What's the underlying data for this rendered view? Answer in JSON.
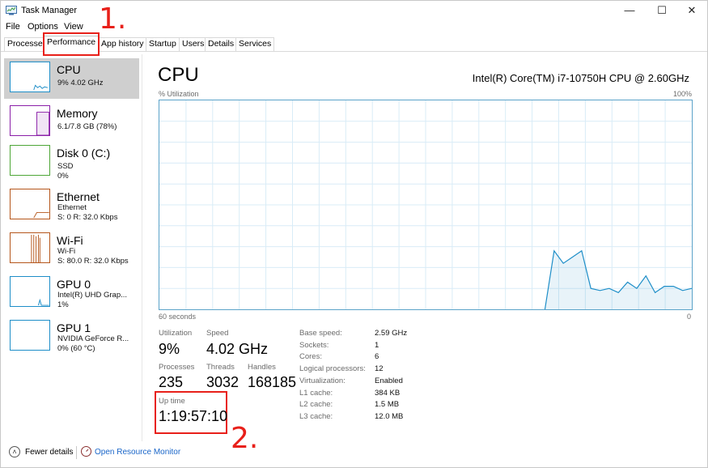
{
  "window": {
    "title": "Task Manager",
    "controls": {
      "minimize": "—",
      "maximize": "☐",
      "close": "✕"
    }
  },
  "menu": [
    "File",
    "Options",
    "View"
  ],
  "tabs": [
    {
      "label": "Processes",
      "active": false
    },
    {
      "label": "Performance",
      "active": true
    },
    {
      "label": "App history",
      "active": false
    },
    {
      "label": "Startup",
      "active": false
    },
    {
      "label": "Users",
      "active": false
    },
    {
      "label": "Details",
      "active": false
    },
    {
      "label": "Services",
      "active": false
    }
  ],
  "annotations": {
    "step1": "1.",
    "step2": "2."
  },
  "sidebar": [
    {
      "title": "CPU",
      "sub1": "9%  4.02 GHz",
      "color": "#1e8ec8",
      "selected": true
    },
    {
      "title": "Memory",
      "sub1": "6.1/7.8 GB (78%)",
      "color": "#8b1fa8",
      "selected": false
    },
    {
      "title": "Disk 0 (C:)",
      "sub1": "SSD",
      "sub2": "0%",
      "color": "#4da636",
      "selected": false
    },
    {
      "title": "Ethernet",
      "sub1": "Ethernet",
      "sub2": "S: 0  R: 32.0 Kbps",
      "color": "#b5561b",
      "selected": false
    },
    {
      "title": "Wi-Fi",
      "sub1": "Wi-Fi",
      "sub2": "S: 80.0  R: 32.0 Kbps",
      "color": "#b5561b",
      "selected": false
    },
    {
      "title": "GPU 0",
      "sub1": "Intel(R) UHD Grap...",
      "sub2": "1%",
      "color": "#1e8ec8",
      "selected": false
    },
    {
      "title": "GPU 1",
      "sub1": "NVIDIA GeForce R...",
      "sub2": "0%  (60 °C)",
      "color": "#1e8ec8",
      "selected": false
    }
  ],
  "main": {
    "title": "CPU",
    "cpu_name": "Intel(R) Core(TM) i7-10750H CPU @ 2.60GHz",
    "axis": {
      "top_left": "% Utilization",
      "top_right": "100%",
      "bottom_left": "60 seconds",
      "bottom_right": "0"
    },
    "stats": {
      "utilization": {
        "label": "Utilization",
        "value": "9%"
      },
      "speed": {
        "label": "Speed",
        "value": "4.02 GHz"
      },
      "processes": {
        "label": "Processes",
        "value": "235"
      },
      "threads": {
        "label": "Threads",
        "value": "3032"
      },
      "handles": {
        "label": "Handles",
        "value": "168185"
      },
      "uptime": {
        "label": "Up time",
        "value": "1:19:57:10"
      }
    },
    "details": [
      {
        "label": "Base speed:",
        "value": "2.59 GHz"
      },
      {
        "label": "Sockets:",
        "value": "1"
      },
      {
        "label": "Cores:",
        "value": "6"
      },
      {
        "label": "Logical processors:",
        "value": "12"
      },
      {
        "label": "Virtualization:",
        "value": "Enabled"
      },
      {
        "label": "L1 cache:",
        "value": "384 KB"
      },
      {
        "label": "L2 cache:",
        "value": "1.5 MB"
      },
      {
        "label": "L3 cache:",
        "value": "12.0 MB"
      }
    ]
  },
  "cpu_history_percent": [
    null,
    null,
    null,
    null,
    null,
    null,
    null,
    null,
    null,
    null,
    null,
    null,
    null,
    null,
    null,
    null,
    null,
    null,
    null,
    null,
    null,
    null,
    null,
    null,
    null,
    null,
    null,
    null,
    null,
    null,
    null,
    null,
    null,
    null,
    null,
    null,
    null,
    null,
    null,
    null,
    null,
    null,
    0,
    28,
    22,
    25,
    28,
    10,
    9,
    10,
    8,
    13,
    10,
    16,
    8,
    11,
    11,
    9,
    10
  ],
  "footer": {
    "fewer_details": "Fewer details",
    "resource_monitor": "Open Resource Monitor"
  },
  "colors": {
    "accent": "#1e8ec8",
    "annotation": "#e8201a",
    "link": "#1a66c9"
  }
}
